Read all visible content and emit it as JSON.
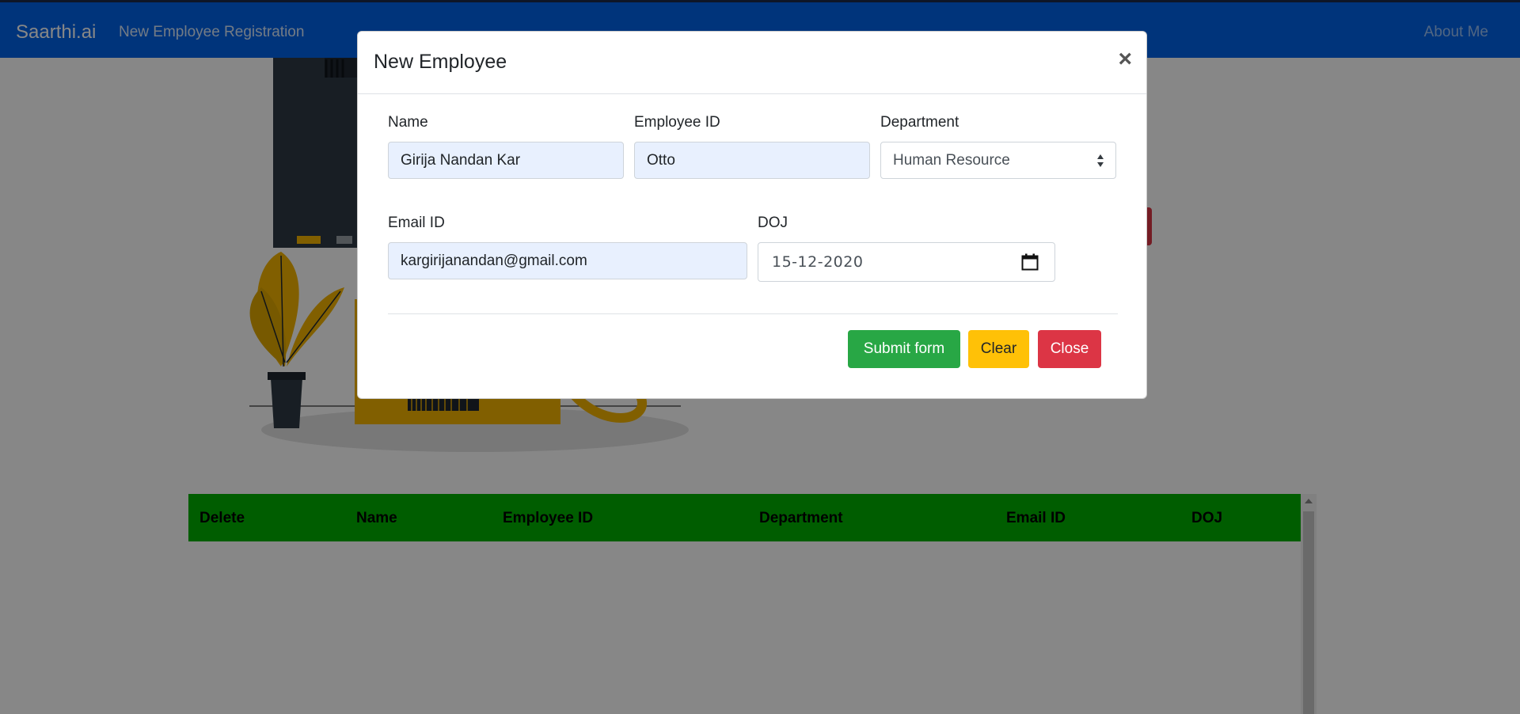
{
  "navbar": {
    "brand": "Saarthi.ai",
    "link": "New Employee Registration",
    "about": "About Me"
  },
  "table": {
    "headers": [
      "Delete",
      "Name",
      "Employee ID",
      "Department",
      "Email ID",
      "DOJ"
    ]
  },
  "modal": {
    "title": "New Employee",
    "close_symbol": "×",
    "fields": {
      "name_label": "Name",
      "name_value": "Girija Nandan Kar",
      "employee_id_label": "Employee ID",
      "employee_id_value": "Otto",
      "department_label": "Department",
      "department_value": "Human Resource",
      "email_label": "Email ID",
      "email_value": "kargirijanandan@gmail.com",
      "doj_label": "DOJ",
      "doj_value": "15-12-2020"
    },
    "buttons": {
      "submit": "Submit form",
      "clear": "Clear",
      "close": "Close"
    }
  },
  "colors": {
    "navbar": "#0063e8",
    "table_header": "#00b000",
    "submit": "#28a745",
    "clear": "#ffc107",
    "close": "#dc3545"
  },
  "icons": [
    "calendar-icon",
    "select-caret-icon",
    "close-icon"
  ]
}
